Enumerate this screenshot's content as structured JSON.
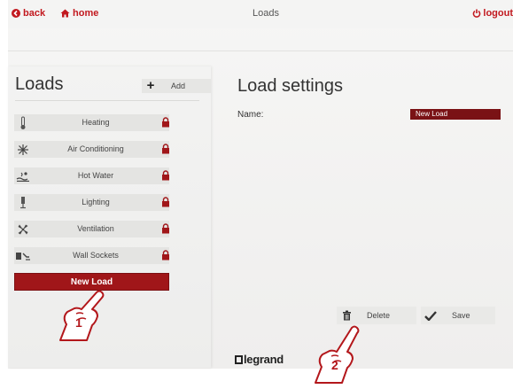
{
  "topbar": {
    "back_label": "back",
    "home_label": "home",
    "title": "Loads",
    "logout_label": "logout"
  },
  "left": {
    "title": "Loads",
    "add_label": "Add",
    "items": [
      {
        "label": "Heating",
        "icon": "thermometer-icon"
      },
      {
        "label": "Air Conditioning",
        "icon": "snowflake-icon"
      },
      {
        "label": "Hot Water",
        "icon": "hot-water-icon"
      },
      {
        "label": "Lighting",
        "icon": "lamp-icon"
      },
      {
        "label": "Ventilation",
        "icon": "fan-icon"
      },
      {
        "label": "Wall Sockets",
        "icon": "socket-plug-icon"
      }
    ],
    "new_load_label": "New Load"
  },
  "right": {
    "title": "Load settings",
    "name_label": "Name:",
    "name_value": "New Load",
    "delete_label": "Delete",
    "save_label": "Save"
  },
  "brand": "legrand",
  "callouts": [
    {
      "number": "1"
    },
    {
      "number": "2"
    }
  ],
  "colors": {
    "accent": "#c2191f",
    "button_red": "#a01619",
    "field_red": "#7a1215",
    "panel_bg": "#efefee"
  }
}
